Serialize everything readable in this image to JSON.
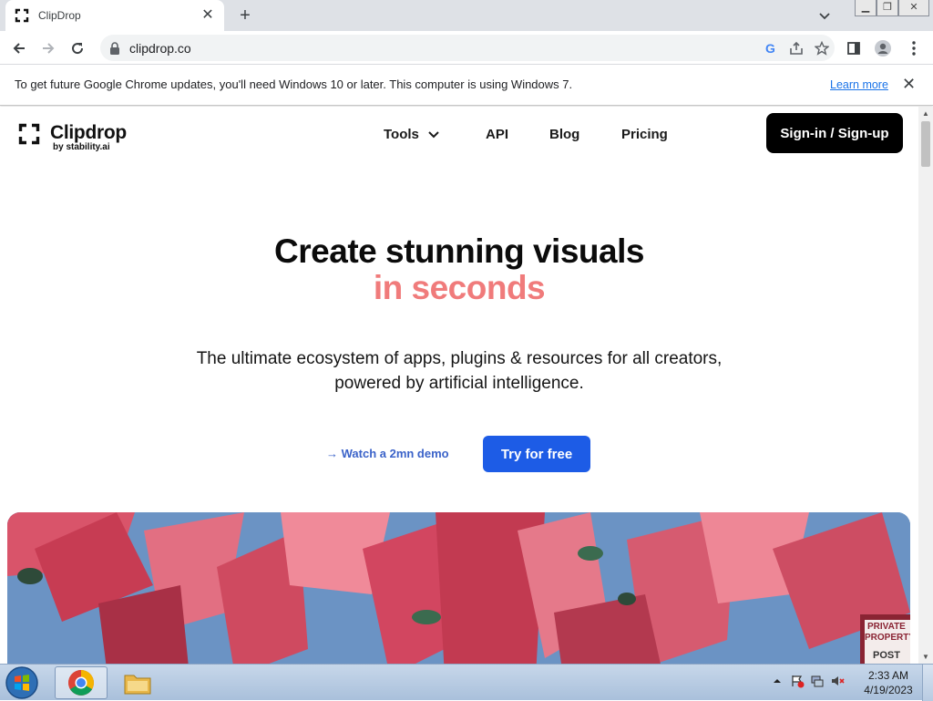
{
  "browser": {
    "tab_title": "ClipDrop",
    "url": "clipdrop.co",
    "infobar_text": "To get future Google Chrome updates, you'll need Windows 10 or later. This computer is using Windows 7.",
    "infobar_link": "Learn more"
  },
  "site": {
    "logo_word": "Clipdrop",
    "logo_sub": "by stability.ai",
    "nav": [
      "Tools",
      "API",
      "Blog",
      "Pricing"
    ],
    "signin_label": "Sign-in / Sign-up",
    "hero_line1": "Create stunning visuals",
    "hero_line2": "in seconds",
    "subtitle_line1": "The ultimate ecosystem of apps, plugins & resources for all creators,",
    "subtitle_line2": "powered by artificial intelligence.",
    "demo_label": "→ Watch a 2mn demo",
    "try_label": "Try for free",
    "hero_image_sign": [
      "PRIVATE",
      "PROPERTY",
      "POST"
    ],
    "colors": {
      "accent_text": "#f07b7b",
      "primary_button": "#1d5ce6",
      "signin_button": "#000000",
      "demo_link": "#3b63c9"
    }
  },
  "taskbar": {
    "time": "2:33 AM",
    "date": "4/19/2023"
  }
}
